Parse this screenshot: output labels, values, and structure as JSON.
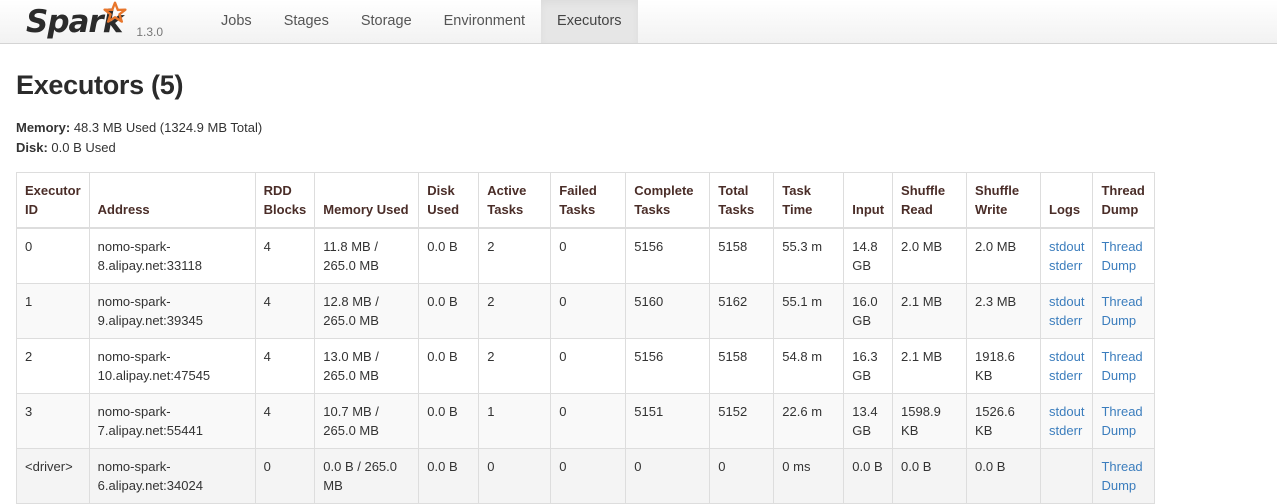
{
  "navbar": {
    "brand_text": "Spark",
    "version": "1.3.0",
    "tabs": [
      {
        "label": "Jobs",
        "active": false
      },
      {
        "label": "Stages",
        "active": false
      },
      {
        "label": "Storage",
        "active": false
      },
      {
        "label": "Environment",
        "active": false
      },
      {
        "label": "Executors",
        "active": true
      }
    ]
  },
  "page": {
    "title": "Executors (5)",
    "memory_label": "Memory:",
    "memory_value": "48.3 MB Used (1324.9 MB Total)",
    "disk_label": "Disk:",
    "disk_value": "0.0 B Used"
  },
  "table": {
    "headers": [
      "Executor ID",
      "Address",
      "RDD Blocks",
      "Memory Used",
      "Disk Used",
      "Active Tasks",
      "Failed Tasks",
      "Complete Tasks",
      "Total Tasks",
      "Task Time",
      "Input",
      "Shuffle Read",
      "Shuffle Write",
      "Logs",
      "Thread Dump"
    ],
    "rows": [
      {
        "executor_id": "0",
        "address": "nomo-spark-8.alipay.net:33118",
        "rdd_blocks": "4",
        "memory_used": "11.8 MB / 265.0 MB",
        "disk_used": "0.0 B",
        "active_tasks": "2",
        "failed_tasks": "0",
        "complete_tasks": "5156",
        "total_tasks": "5158",
        "task_time": "55.3 m",
        "input": "14.8 GB",
        "shuffle_read": "2.0 MB",
        "shuffle_write": "2.0 MB",
        "logs": [
          "stdout",
          "stderr"
        ],
        "thread_dump": "Thread Dump"
      },
      {
        "executor_id": "1",
        "address": "nomo-spark-9.alipay.net:39345",
        "rdd_blocks": "4",
        "memory_used": "12.8 MB / 265.0 MB",
        "disk_used": "0.0 B",
        "active_tasks": "2",
        "failed_tasks": "0",
        "complete_tasks": "5160",
        "total_tasks": "5162",
        "task_time": "55.1 m",
        "input": "16.0 GB",
        "shuffle_read": "2.1 MB",
        "shuffle_write": "2.3 MB",
        "logs": [
          "stdout",
          "stderr"
        ],
        "thread_dump": "Thread Dump"
      },
      {
        "executor_id": "2",
        "address": "nomo-spark-10.alipay.net:47545",
        "rdd_blocks": "4",
        "memory_used": "13.0 MB / 265.0 MB",
        "disk_used": "0.0 B",
        "active_tasks": "2",
        "failed_tasks": "0",
        "complete_tasks": "5156",
        "total_tasks": "5158",
        "task_time": "54.8 m",
        "input": "16.3 GB",
        "shuffle_read": "2.1 MB",
        "shuffle_write": "1918.6 KB",
        "logs": [
          "stdout",
          "stderr"
        ],
        "thread_dump": "Thread Dump"
      },
      {
        "executor_id": "3",
        "address": "nomo-spark-7.alipay.net:55441",
        "rdd_blocks": "4",
        "memory_used": "10.7 MB / 265.0 MB",
        "disk_used": "0.0 B",
        "active_tasks": "1",
        "failed_tasks": "0",
        "complete_tasks": "5151",
        "total_tasks": "5152",
        "task_time": "22.6 m",
        "input": "13.4 GB",
        "shuffle_read": "1598.9 KB",
        "shuffle_write": "1526.6 KB",
        "logs": [
          "stdout",
          "stderr"
        ],
        "thread_dump": "Thread Dump"
      },
      {
        "executor_id": "<driver>",
        "address": "nomo-spark-6.alipay.net:34024",
        "rdd_blocks": "0",
        "memory_used": "0.0 B / 265.0 MB",
        "disk_used": "0.0 B",
        "active_tasks": "0",
        "failed_tasks": "0",
        "complete_tasks": "0",
        "total_tasks": "0",
        "task_time": "0 ms",
        "input": "0.0 B",
        "shuffle_read": "0.0 B",
        "shuffle_write": "0.0 B",
        "logs": [],
        "thread_dump": "Thread Dump"
      }
    ]
  },
  "colors": {
    "link": "#3b7dbd",
    "header_text": "#4a2d28",
    "logo_star": "#e8762c",
    "active_tab_bg": "#e6e6e6"
  }
}
